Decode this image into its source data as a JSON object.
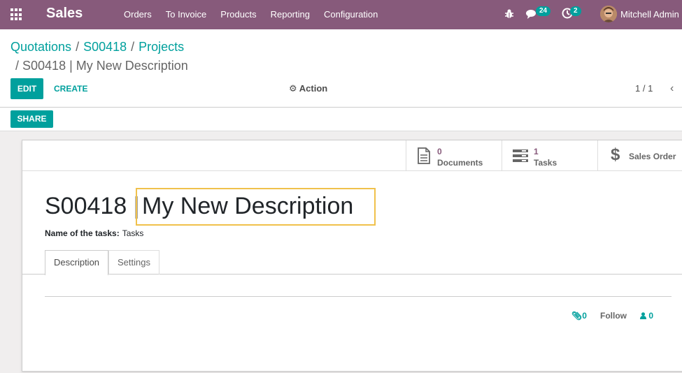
{
  "navbar": {
    "app_name": "Sales",
    "menu": [
      "Orders",
      "To Invoice",
      "Products",
      "Reporting",
      "Configuration"
    ],
    "messages_count": "24",
    "activities_count": "2",
    "user_name": "Mitchell Admin"
  },
  "breadcrumb": {
    "items": [
      "Quotations",
      "S00418",
      "Projects"
    ],
    "current": "S00418 | My New Description"
  },
  "control": {
    "edit_label": "EDIT",
    "create_label": "CREATE",
    "action_label": "Action",
    "pager": "1 / 1",
    "share_label": "SHARE"
  },
  "stat_buttons": {
    "documents_count": "0",
    "documents_label": "Documents",
    "tasks_count": "1",
    "tasks_label": "Tasks",
    "sales_order_label": "Sales Order"
  },
  "form": {
    "title_prefix": "S00418 |",
    "title_value": "My New Description",
    "tasks_name_label": "Name of the tasks:",
    "tasks_name_value": "Tasks",
    "tabs": [
      "Description",
      "Settings"
    ]
  },
  "chatter": {
    "attachments_count": "0",
    "follow_label": "Follow",
    "followers_count": "0"
  },
  "colors": {
    "brand": "#875a7b",
    "accent": "#00a09d",
    "focus": "#f0c14b"
  }
}
